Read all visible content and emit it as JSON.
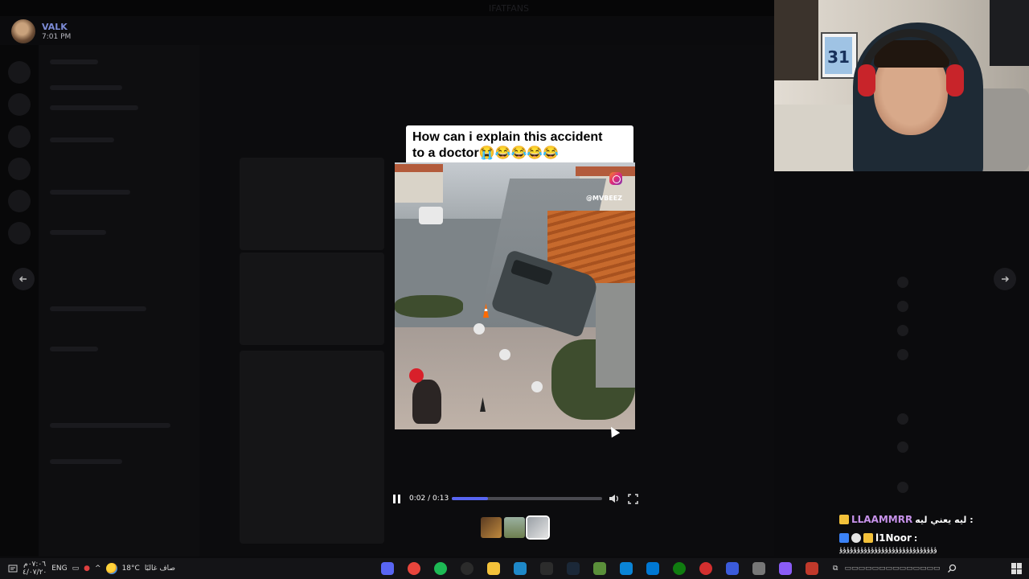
{
  "background": {
    "header_label": "IFATFANS"
  },
  "streamer": {
    "name": "VALK",
    "time": "7:01 PM"
  },
  "viewer": {
    "caption_line1": "How can i explain this accident",
    "caption_line2": "to a doctor😭😂😂😂😂",
    "watermark": "@MVBEEZ",
    "time_display": "0:02 / 0:13",
    "progress": 0.24,
    "accent_color": "#5865f2"
  },
  "webcam": {
    "jersey_number": "31"
  },
  "chat": {
    "messages": [
      {
        "user": "LLAAMMRR",
        "text": "ليه يعني ليه :",
        "color": "#c792ea"
      },
      {
        "user": "l1Noor",
        "text": ":",
        "color": "#ffffff"
      }
    ],
    "trailing_text": "ؤؤؤؤؤؤؤؤؤؤؤؤؤؤؤؤؤؤؤؤؤؤؤؤؤؤؤؤ"
  },
  "taskbar": {
    "clock_time": "٠٧:٠٦م",
    "clock_date": "٤/٠٧/٢٠",
    "language": "ENG",
    "weather_temp": "18°C",
    "weather_text": "صاف غالبًا",
    "apps": [
      {
        "icon": "discord-icon",
        "color": "#5865f2"
      },
      {
        "icon": "chrome-icon",
        "color": "#e8453c"
      },
      {
        "icon": "spotify-icon",
        "color": "#1db954"
      },
      {
        "icon": "obs-icon",
        "color": "#2b2b2b"
      },
      {
        "icon": "file-explorer-icon",
        "color": "#f3c13a"
      },
      {
        "icon": "edge-icon",
        "color": "#1e88c8"
      },
      {
        "icon": "terminal-icon",
        "color": "#2c2c2c"
      },
      {
        "icon": "steam-icon",
        "color": "#1b2838"
      },
      {
        "icon": "minecraft-icon",
        "color": "#5a8f3a"
      },
      {
        "icon": "photo-app-icon",
        "color": "#0a84d6"
      },
      {
        "icon": "store-icon",
        "color": "#0078d4"
      },
      {
        "icon": "xbox-icon",
        "color": "#107c10"
      },
      {
        "icon": "red-app-icon",
        "color": "#d32f2f"
      },
      {
        "icon": "blue-app-icon",
        "color": "#3b5bdb"
      },
      {
        "icon": "settings-cog-icon",
        "color": "#777777"
      },
      {
        "icon": "copilot-icon",
        "color": "#8a5cf6"
      },
      {
        "icon": "archive-icon",
        "color": "#c0392b"
      }
    ]
  }
}
